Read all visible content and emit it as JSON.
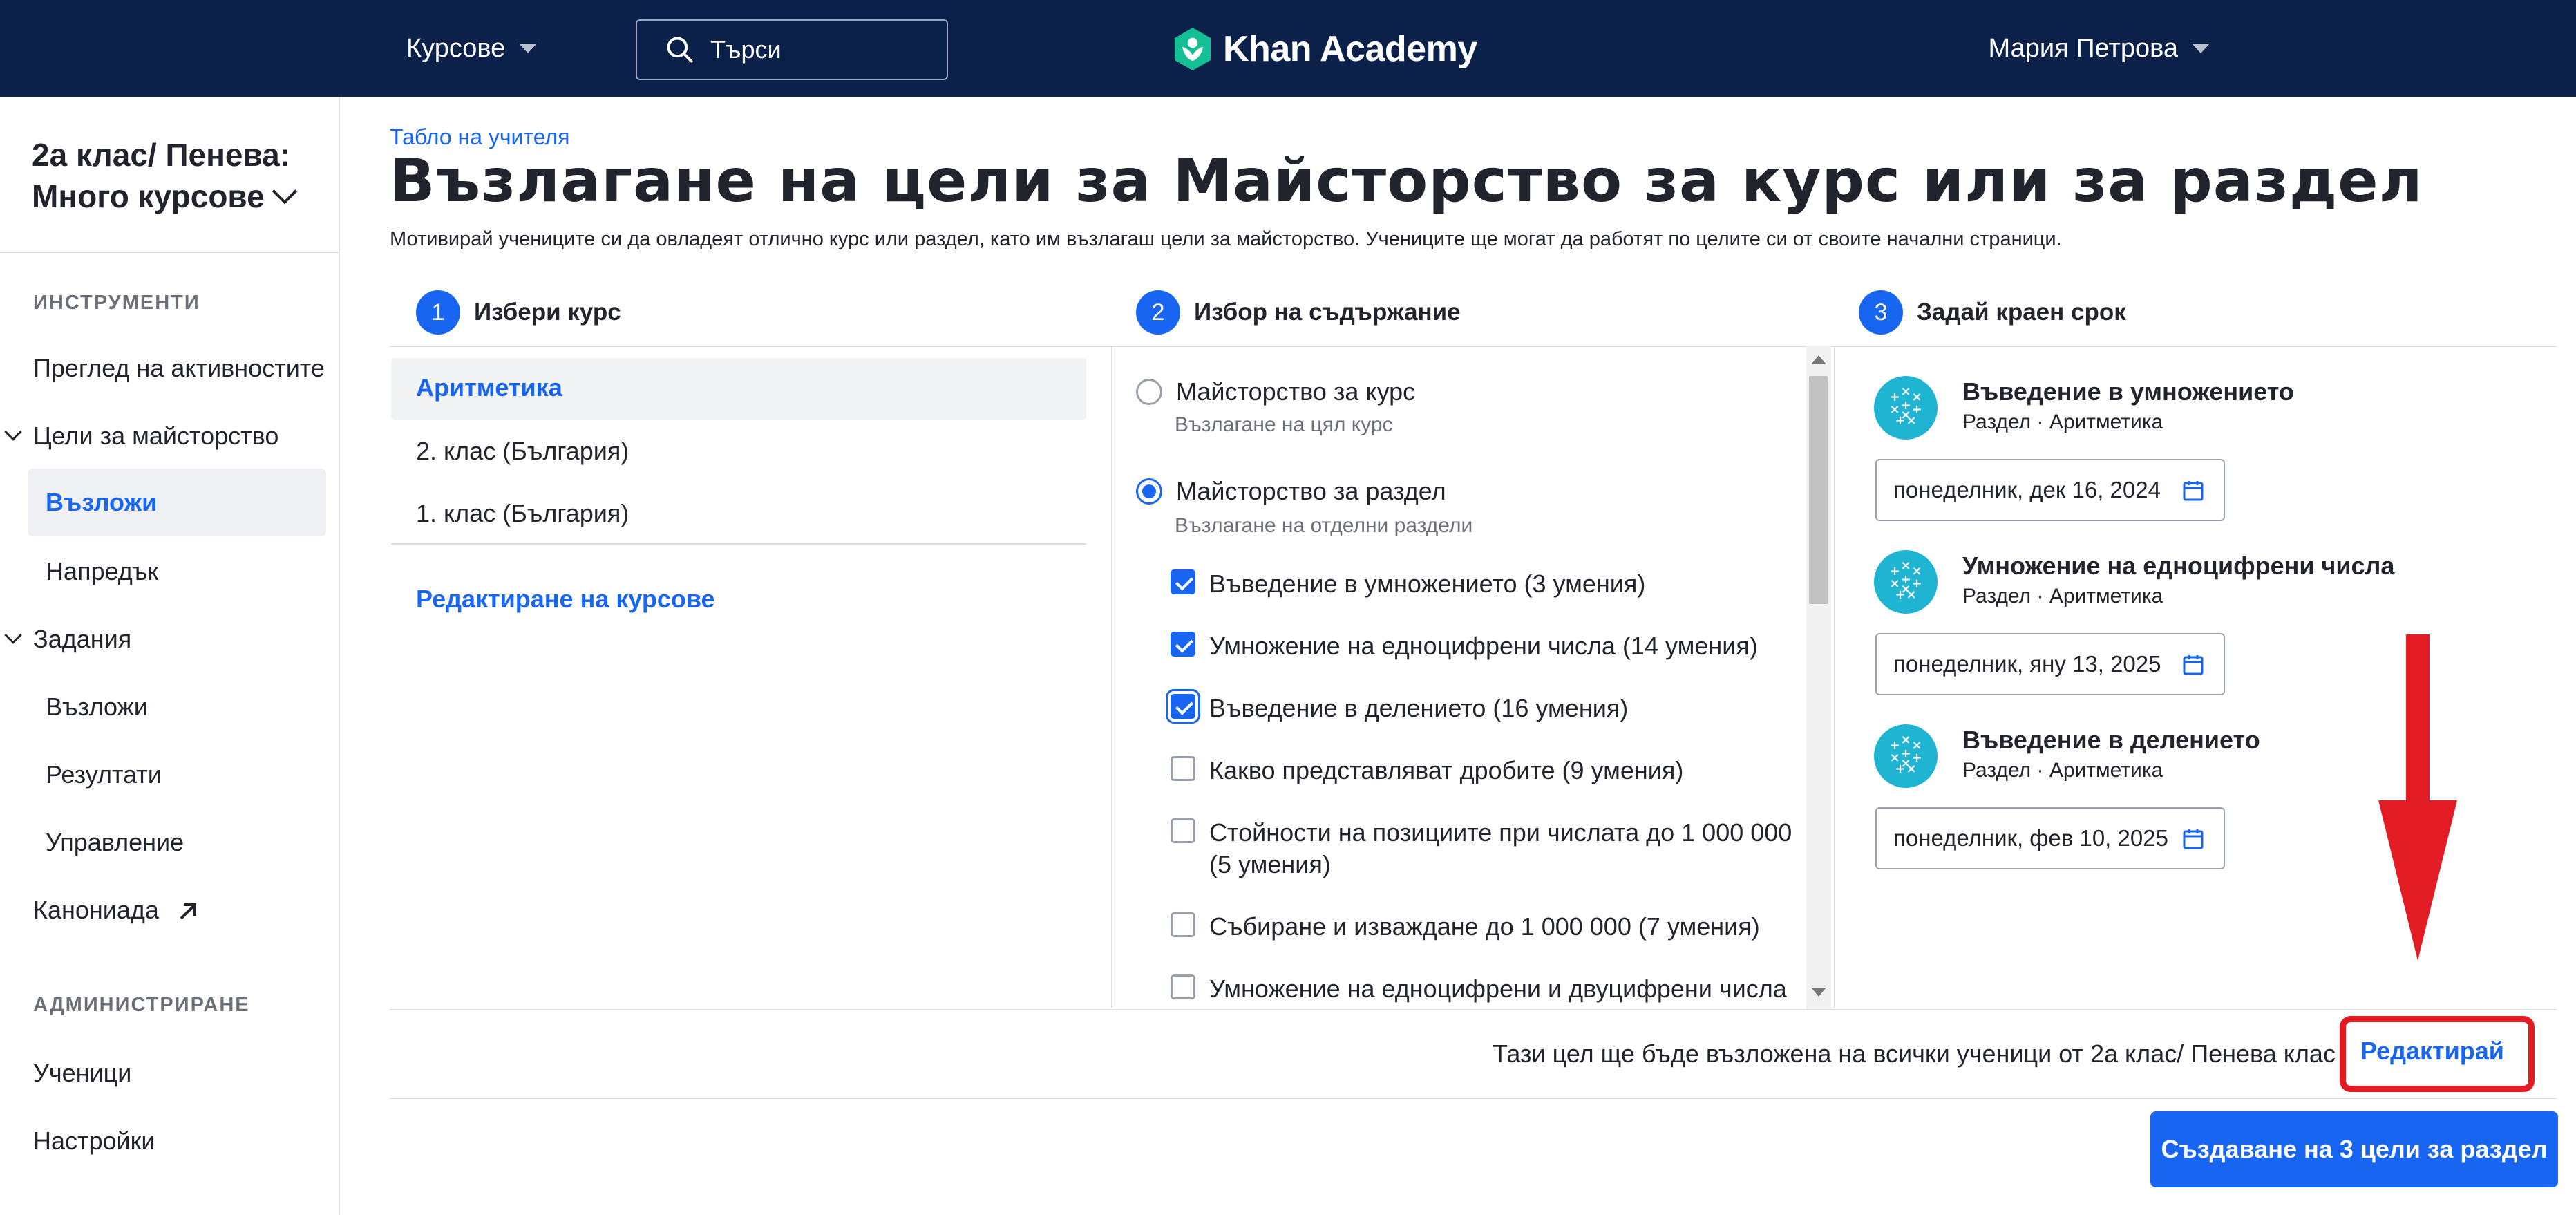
{
  "header": {
    "courses_label": "Курсове",
    "search_placeholder": "Търси",
    "logo_text": "Khan Academy",
    "user_name": "Мария Петрова"
  },
  "sidebar": {
    "class_name_line1": "2а клас/ Пенева:",
    "class_name_line2": "Много курсове",
    "tools_heading": "ИНСТРУМЕНТИ",
    "activity_overview": "Преглед на активностите",
    "mastery_goals": "Цели за майсторство",
    "mastery_assign": "Възложи",
    "mastery_progress": "Напредък",
    "assignments": "Задания",
    "assignments_assign": "Възложи",
    "assignments_results": "Резултати",
    "assignments_manage": "Управление",
    "canonical": "Канониада",
    "admin_heading": "АДМИНИСТРИРАНЕ",
    "students": "Ученици",
    "settings": "Настройки"
  },
  "main": {
    "breadcrumb": "Табло на учителя",
    "title": "Възлагане на цели за Майсторство за курс или за раздел",
    "description": "Мотивирай учениците си да овладеят отлично курс или раздел, като им възлагаш цели за майсторство. Учениците ще могат да работят по целите си от своите начални страници.",
    "steps": [
      {
        "num": "1",
        "label": "Избери курс"
      },
      {
        "num": "2",
        "label": "Избор на съдържание"
      },
      {
        "num": "3",
        "label": "Задай краен срок"
      }
    ],
    "courses": [
      "Аритметика",
      "2. клас (България)",
      "1. клас (България)"
    ],
    "edit_courses": "Редактиране на курсове",
    "content": {
      "course_mastery_label": "Майсторство за курс",
      "course_mastery_sub": "Възлагане на цял курс",
      "unit_mastery_label": "Майсторство за раздел",
      "unit_mastery_sub": "Възлагане на отделни раздели",
      "units": [
        {
          "label": "Въведение в умножението (3 умения)",
          "checked": true
        },
        {
          "label": "Умножение на едноцифрени числа (14 умения)",
          "checked": true
        },
        {
          "label": "Въведение в делението (16 умения)",
          "checked": true
        },
        {
          "label": "Какво представляват дробите (9 умения)",
          "checked": false
        },
        {
          "label": "Стойности на позициите при числата до 1 000 000 (5 умения)",
          "checked": false
        },
        {
          "label": "Събиране и изваждане до 1 000 000 (7 умения)",
          "checked": false
        },
        {
          "label": "Умножение на едноцифрени и двуцифрени числа",
          "checked": false
        }
      ]
    },
    "goals": [
      {
        "title": "Въведение в умножението",
        "sub": "Раздел · Аритметика",
        "date": "понеделник, дек 16, 2024"
      },
      {
        "title": "Умножение на едноцифрени числа",
        "sub": "Раздел · Аритметика",
        "date": "понеделник, яну 13, 2025"
      },
      {
        "title": "Въведение в делението",
        "sub": "Раздел · Аритметика",
        "date": "понеделник, фев 10, 2025"
      }
    ],
    "assign_note": "Тази цел ще бъде възложена на всички ученици от 2а клас/ Пенева клас",
    "edit_link": "Редактирай",
    "create_button": "Създаване на 3 цели за раздел"
  },
  "colors": {
    "navbar": "#0b2149",
    "accent": "#1865f2",
    "highlight": "#e31b23",
    "logo_green": "#14bf96",
    "goal_icon": "#1fb4d2"
  }
}
